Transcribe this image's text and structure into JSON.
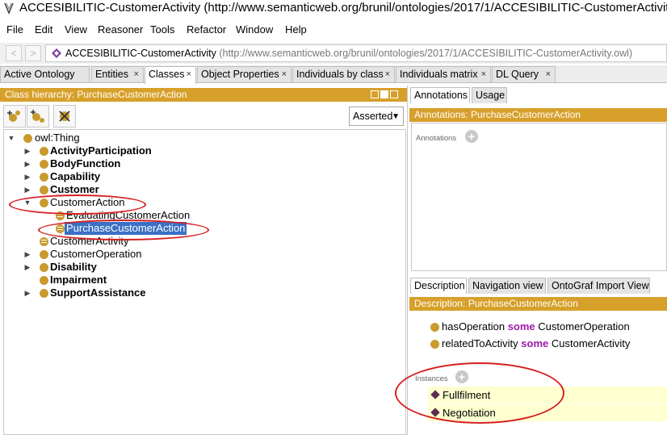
{
  "window": {
    "title": "ACCESIBILITIC-CustomerActivity (http://www.semanticweb.org/brunil/ontologies/2017/1/ACCESIBILITIC-CustomerActivity."
  },
  "menu": [
    "File",
    "Edit",
    "View",
    "Reasoner",
    "Tools",
    "Refactor",
    "Window",
    "Help"
  ],
  "address": {
    "back": "<",
    "forward": ">",
    "name": "ACCESIBILITIC-CustomerActivity",
    "uri": "(http://www.semanticweb.org/brunil/ontologies/2017/1/ACCESIBILITIC-CustomerActivity.owl)"
  },
  "tabs": [
    {
      "label": "Active Ontology",
      "closable": false,
      "active": false
    },
    {
      "label": "Entities",
      "closable": true,
      "active": false
    },
    {
      "label": "Classes",
      "closable": true,
      "active": true
    },
    {
      "label": "Object Properties",
      "closable": true,
      "active": false
    },
    {
      "label": "Individuals by class",
      "closable": true,
      "active": false
    },
    {
      "label": "Individuals matrix",
      "closable": true,
      "active": false
    },
    {
      "label": "DL Query",
      "closable": true,
      "active": false
    }
  ],
  "tab_close_glyph": "×",
  "class_hierarchy": {
    "header": "Class hierarchy: PurchaseCustomerAction",
    "mode": "Asserted",
    "tree": [
      {
        "label": "owl:Thing",
        "bold": false,
        "toggle": "expanded",
        "kind": "class",
        "selected": false
      },
      {
        "label": "ActivityParticipation",
        "bold": true,
        "toggle": "collapsed",
        "kind": "class",
        "selected": false
      },
      {
        "label": "BodyFunction",
        "bold": true,
        "toggle": "collapsed",
        "kind": "class",
        "selected": false
      },
      {
        "label": "Capability",
        "bold": true,
        "toggle": "collapsed",
        "kind": "class",
        "selected": false
      },
      {
        "label": "Customer",
        "bold": true,
        "toggle": "collapsed",
        "kind": "class",
        "selected": false
      },
      {
        "label": "CustomerAction",
        "bold": false,
        "toggle": "expanded",
        "kind": "class",
        "selected": false
      },
      {
        "label": "EvaluatingCustomerAction",
        "bold": false,
        "toggle": "none",
        "kind": "defined",
        "selected": false
      },
      {
        "label": "PurchaseCustomerAction",
        "bold": false,
        "toggle": "none",
        "kind": "defined",
        "selected": true
      },
      {
        "label": "CustomerActivity",
        "bold": false,
        "toggle": "none",
        "kind": "defined",
        "selected": false
      },
      {
        "label": "CustomerOperation",
        "bold": false,
        "toggle": "collapsed",
        "kind": "class",
        "selected": false
      },
      {
        "label": "Disability",
        "bold": true,
        "toggle": "collapsed",
        "kind": "class",
        "selected": false
      },
      {
        "label": "Impairment",
        "bold": true,
        "toggle": "none",
        "kind": "class",
        "selected": false
      },
      {
        "label": "SupportAssistance",
        "bold": true,
        "toggle": "collapsed",
        "kind": "class",
        "selected": false
      }
    ]
  },
  "annotations": {
    "tabs": [
      "Annotations",
      "Usage"
    ],
    "header": "Annotations: PurchaseCustomerAction",
    "section_label": "Annotations"
  },
  "description": {
    "tabs": [
      "Description",
      "Navigation view",
      "OntoGraf Import View"
    ],
    "header": "Description: PurchaseCustomerAction",
    "restrictions": [
      {
        "property": "hasOperation",
        "keyword": "some",
        "filler": "CustomerOperation"
      },
      {
        "property": "relatedToActivity",
        "keyword": "some",
        "filler": "CustomerActivity"
      }
    ],
    "instances_label": "Instances",
    "instances": [
      "Fullfilment",
      "Negotiation"
    ]
  },
  "colors": {
    "header_gold": "#d7a02b",
    "selection_blue": "#3b70c5",
    "highlight_red": "#d62020",
    "keyword_purple": "#9b1ba8",
    "instance_bg": "#ffffd0"
  }
}
